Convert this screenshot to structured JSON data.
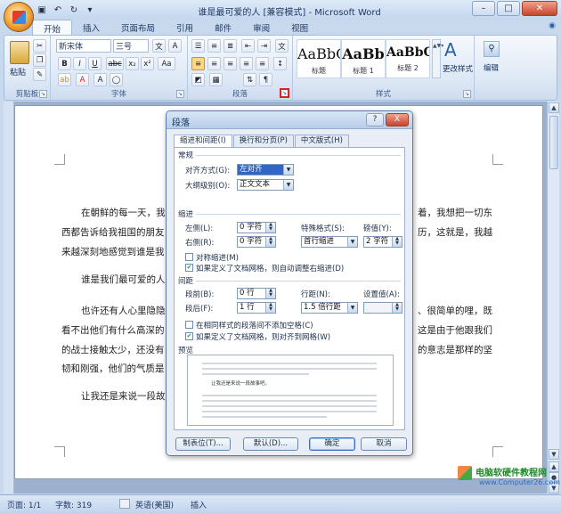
{
  "window": {
    "title": "谁是最可爱的人 [兼容模式] - Microsoft Word"
  },
  "qat": [
    "save-icon",
    "undo-icon",
    "redo-icon",
    "customize-icon"
  ],
  "tabs": [
    "开始",
    "插入",
    "页面布局",
    "引用",
    "邮件",
    "审阅",
    "视图"
  ],
  "ribbon": {
    "clipboard": {
      "label": "剪贴板",
      "paste": "粘贴"
    },
    "font": {
      "label": "字体",
      "font_name": "新宋体",
      "font_size": "三号",
      "buttons": [
        "B",
        "I",
        "U",
        "abc",
        "x₂",
        "x²",
        "Aa",
        "A",
        "A"
      ]
    },
    "paragraph": {
      "label": "段落"
    },
    "styles": {
      "label": "样式",
      "items": [
        {
          "sample": "AaBbC",
          "name": "标题"
        },
        {
          "sample": "AaBb",
          "name": "标题 1"
        },
        {
          "sample": "AaBbC",
          "name": "标题 2"
        }
      ],
      "change": "更改样式"
    },
    "editing": {
      "label": "编辑"
    }
  },
  "document": {
    "lines": [
      "在朝鲜的每一天，我",
      "西都告诉给我祖国的朋友",
      "来越深刻地感觉到谁是我",
      "谁是我们最可爱的人",
      "也许还有人心里隐隐",
      "看不出他们有什么高深的",
      "的战士接触太少，还没有",
      "韧和刚强，他们的气质是",
      "让我还是来说一段故"
    ],
    "right_lines": [
      "着，我想把一切东",
      "历，这就是，我越",
      "、很简单的哩，既",
      "这是由于他跟我们",
      "的意志是那样的坚"
    ]
  },
  "dialog": {
    "title": "段落",
    "help": "?",
    "close": "X",
    "tabs": [
      "缩进和间距(I)",
      "换行和分页(P)",
      "中文版式(H)"
    ],
    "general": {
      "header": "常规",
      "align_label": "对齐方式(G):",
      "align_value": "左对齐",
      "outline_label": "大纲级别(O):",
      "outline_value": "正文文本"
    },
    "indent": {
      "header": "缩进",
      "left_label": "左侧(L):",
      "left_value": "0 字符",
      "right_label": "右侧(R):",
      "right_value": "0 字符",
      "special_label": "特殊格式(S):",
      "special_value": "首行缩进",
      "by_label": "磅值(Y):",
      "by_value": "2 字符",
      "mirror": "对称缩进(M)",
      "auto_adjust": "如果定义了文档网格，则自动调整右缩进(D)"
    },
    "spacing": {
      "header": "间距",
      "before_label": "段前(B):",
      "before_value": "0 行",
      "after_label": "段后(F):",
      "after_value": "1 行",
      "line_label": "行距(N):",
      "line_value": "1.5 倍行距",
      "at_label": "设置值(A):",
      "at_value": "",
      "no_space": "在相同样式的段落间不添加空格(C)",
      "snap_grid": "如果定义了文档网格，则对齐到网格(W)"
    },
    "preview": {
      "header": "预览",
      "sample": "让我还是来说一段故事吧。"
    },
    "buttons": {
      "tabs": "制表位(T)...",
      "default": "默认(D)...",
      "ok": "确定",
      "cancel": "取消"
    }
  },
  "status": {
    "page": "页面: 1/1",
    "words": "字数: 319",
    "lang": "英语(美国)",
    "mode": "插入"
  },
  "watermark": {
    "line1": "电脑软硬件教程网",
    "line2": "www.Computer26.com"
  },
  "colors": {
    "accent": "#2a5fa8",
    "close": "#c8442c"
  }
}
